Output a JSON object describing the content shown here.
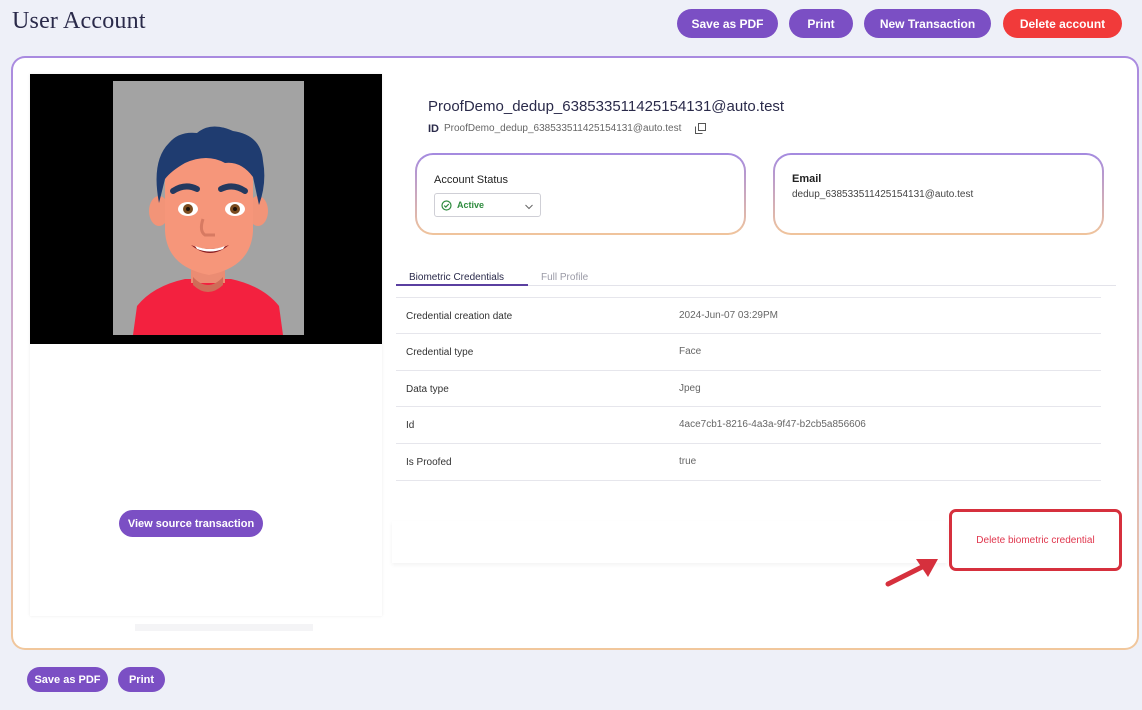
{
  "page": {
    "title": "User Account"
  },
  "toolbar": {
    "save_pdf": "Save as PDF",
    "print": "Print",
    "new_transaction": "New Transaction",
    "delete_account": "Delete account"
  },
  "account": {
    "name": "ProofDemo_dedup_638533511425154131@auto.test",
    "id_label": "ID",
    "id_value": "ProofDemo_dedup_638533511425154131@auto.test"
  },
  "status_box": {
    "label": "Account Status",
    "value": "Active"
  },
  "email_box": {
    "label": "Email",
    "value": "dedup_638533511425154131@auto.test"
  },
  "left": {
    "view_source": "View source transaction"
  },
  "tabs": [
    {
      "label": "Biometric Credentials",
      "active": true
    },
    {
      "label": "Full Profile",
      "active": false
    }
  ],
  "credentials": [
    {
      "key": "Credential creation date",
      "value": "2024-Jun-07 03:29PM"
    },
    {
      "key": "Credential type",
      "value": "Face"
    },
    {
      "key": "Data type",
      "value": "Jpeg"
    },
    {
      "key": "Id",
      "value": "4ace7cb1-8216-4a3a-9f47-b2cb5a856606"
    },
    {
      "key": "Is Proofed",
      "value": "true"
    }
  ],
  "delete_credential": "Delete biometric credential",
  "footer": {
    "save_pdf": "Save as PDF",
    "print": "Print"
  },
  "colors": {
    "primary": "#7b4fc4",
    "danger": "#f13a3a",
    "highlight": "#d6303d",
    "active_status": "#2e8b3e"
  },
  "icons": {
    "copy": "copy-icon",
    "status": "check-circle-icon",
    "dropdown": "chevron-down-icon",
    "pointer": "red-arrow-icon"
  }
}
